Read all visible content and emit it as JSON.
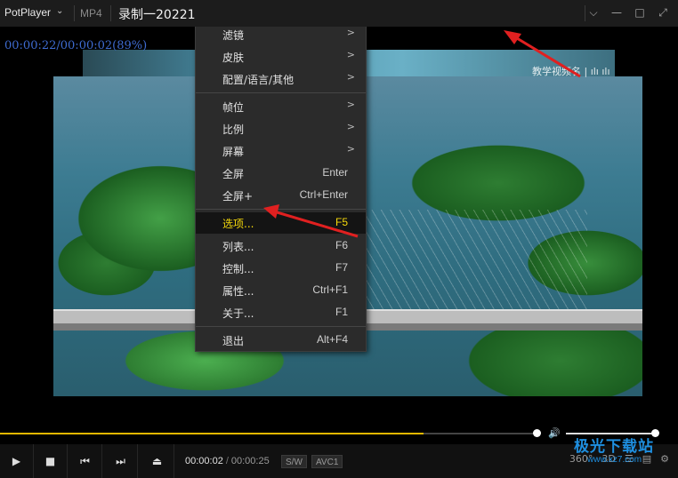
{
  "titlebar": {
    "app_name": "PotPlayer",
    "format": "MP4",
    "filename": "录制一20221",
    "buttons": [
      "pin-icon",
      "minimize-icon",
      "maximize-icon",
      "fullscreen-icon"
    ]
  },
  "video": {
    "osd_time": "00:00:22/00:00:02(89%)",
    "overlay_text": "教学视频名 | ılı ılı"
  },
  "context_menu": {
    "items": [
      {
        "label": "滤镜",
        "shortcut": "",
        "submenu": true
      },
      {
        "label": "皮肤",
        "shortcut": "",
        "submenu": true
      },
      {
        "label": "配置/语言/其他",
        "shortcut": "",
        "submenu": true
      },
      {
        "label": "帧位",
        "shortcut": "",
        "submenu": true
      },
      {
        "label": "比例",
        "shortcut": "",
        "submenu": true
      },
      {
        "label": "屏幕",
        "shortcut": "",
        "submenu": true
      },
      {
        "label": "全屏",
        "shortcut": "Enter",
        "submenu": false
      },
      {
        "label": "全屏+",
        "shortcut": "Ctrl+Enter",
        "submenu": false
      },
      {
        "label": "选项...",
        "shortcut": "F5",
        "submenu": false,
        "highlighted": true
      },
      {
        "label": "列表...",
        "shortcut": "F6",
        "submenu": false
      },
      {
        "label": "控制...",
        "shortcut": "F7",
        "submenu": false
      },
      {
        "label": "属性...",
        "shortcut": "Ctrl+F1",
        "submenu": false
      },
      {
        "label": "关于...",
        "shortcut": "F1",
        "submenu": false
      },
      {
        "label": "退出",
        "shortcut": "Alt+F4",
        "submenu": false
      }
    ],
    "submenu_glyph": ">",
    "highlight_color": "#f5d90a"
  },
  "seekbar": {
    "progress": 0.79,
    "volume": 1.0,
    "accent": "#e6b800"
  },
  "controls": {
    "buttons": [
      "play-icon",
      "stop-icon",
      "previous-icon",
      "next-icon",
      "eject-icon"
    ],
    "current_time": "00:00:02",
    "total_time": "00:00:25",
    "tag_sw": "S/W",
    "tag_codec": "AVC1",
    "right_icons": [
      "360-icon",
      "3d-icon",
      "playlist-icon",
      "subtitles-icon",
      "settings-icon"
    ],
    "label_360": "360°",
    "label_3d": "3D"
  },
  "watermark": {
    "text": "极光下载站",
    "url": "www.xz7.com"
  },
  "annotations": {
    "arrow_color": "#e02020"
  }
}
